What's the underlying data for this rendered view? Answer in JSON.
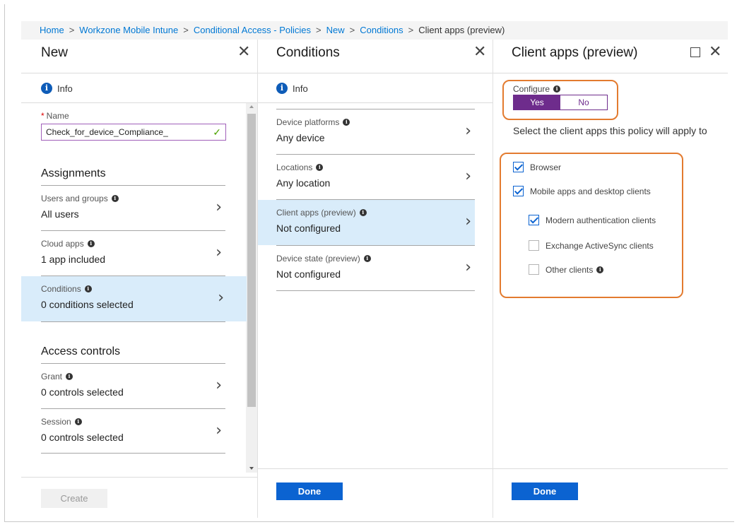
{
  "breadcrumb": {
    "items": [
      "Home",
      "Workzone Mobile Intune",
      "Conditional Access - Policies",
      "New",
      "Conditions"
    ],
    "current": "Client apps (preview)",
    "separator": ">"
  },
  "blade_new": {
    "title": "New",
    "info": "Info",
    "name_label": "Name",
    "name_required": "*",
    "name_value": "Check_for_device_Compliance_",
    "assignments_title": "Assignments",
    "items": [
      {
        "label": "Users and groups",
        "value": "All users"
      },
      {
        "label": "Cloud apps",
        "value": "1 app included"
      },
      {
        "label": "Conditions",
        "value": "0 conditions selected"
      }
    ],
    "access_title": "Access controls",
    "access_items": [
      {
        "label": "Grant",
        "value": "0 controls selected"
      },
      {
        "label": "Session",
        "value": "0 controls selected"
      }
    ],
    "create_label": "Create"
  },
  "blade_conditions": {
    "title": "Conditions",
    "info": "Info",
    "items": [
      {
        "label": "Device platforms",
        "value": "Any device"
      },
      {
        "label": "Locations",
        "value": "Any location"
      },
      {
        "label": "Client apps (preview)",
        "value": "Not configured"
      },
      {
        "label": "Device state (preview)",
        "value": "Not configured"
      }
    ],
    "done_label": "Done"
  },
  "blade_client_apps": {
    "title": "Client apps (preview)",
    "configure_label": "Configure",
    "toggle_yes": "Yes",
    "toggle_no": "No",
    "description": "Select the client apps this policy will apply to",
    "options": [
      {
        "label": "Browser",
        "checked": true
      },
      {
        "label": "Mobile apps and desktop clients",
        "checked": true
      },
      {
        "label": "Modern authentication clients",
        "checked": true
      },
      {
        "label": "Exchange ActiveSync clients",
        "checked": false
      },
      {
        "label": "Other clients",
        "checked": false
      }
    ],
    "done_label": "Done"
  },
  "colors": {
    "accent_blue": "#0b63d1",
    "toggle_purple": "#6e2c8c",
    "highlight_orange": "#e37b2f",
    "selected_row": "#d9ecfa"
  },
  "icons": [
    "close-icon",
    "info-icon",
    "chevron-right-icon",
    "maximize-icon",
    "checkmark-icon"
  ]
}
